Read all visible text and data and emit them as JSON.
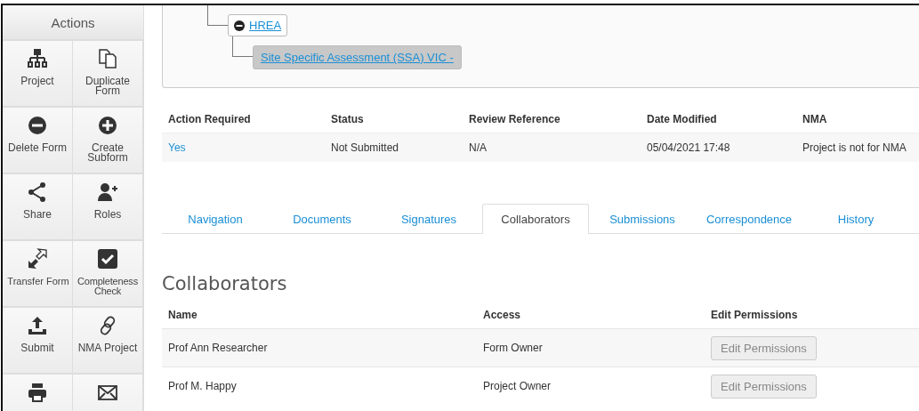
{
  "sidebar": {
    "title": "Actions",
    "actions": [
      "Project",
      "Duplicate Form",
      "Delete Form",
      "Create Subform",
      "Share",
      "Roles",
      "Transfer Form",
      "Completeness Check",
      "Submit",
      "NMA Project"
    ]
  },
  "tree": [
    {
      "label": "HREA",
      "expanded": true,
      "selected": false
    },
    {
      "label": "Site Specific Assessment (SSA) VIC -",
      "selected": true
    }
  ],
  "info_table": {
    "columns": [
      "Action Required",
      "Status",
      "Review Reference",
      "Date Modified",
      "NMA"
    ],
    "rows": [
      [
        {
          "text": "Yes",
          "link": true
        },
        {
          "text": "Not Submitted",
          "link": false
        },
        {
          "text": "N/A",
          "link": false
        },
        {
          "text": "05/04/2021 17:48",
          "link": false
        },
        {
          "text": "Project is not for NMA",
          "link": false
        }
      ]
    ]
  },
  "tabs": [
    {
      "label": "Navigation",
      "selected": false
    },
    {
      "label": "Documents",
      "selected": false
    },
    {
      "label": "Signatures",
      "selected": false
    },
    {
      "label": "Collaborators",
      "selected": true
    },
    {
      "label": "Submissions",
      "selected": false
    },
    {
      "label": "Correspondence",
      "selected": false
    },
    {
      "label": "History",
      "selected": false
    }
  ],
  "section_title": "Collaborators",
  "collaborators": {
    "columns": [
      "Name",
      "Access",
      "Edit Permissions"
    ],
    "rows": [
      {
        "name": "Prof Ann Researcher",
        "access": "Form Owner",
        "button": {
          "label": "Edit Permissions",
          "disabled": true
        }
      },
      {
        "name": "Prof M. Happy",
        "access": "Project Owner",
        "button": {
          "label": "Edit Permissions",
          "disabled": true
        }
      }
    ]
  }
}
